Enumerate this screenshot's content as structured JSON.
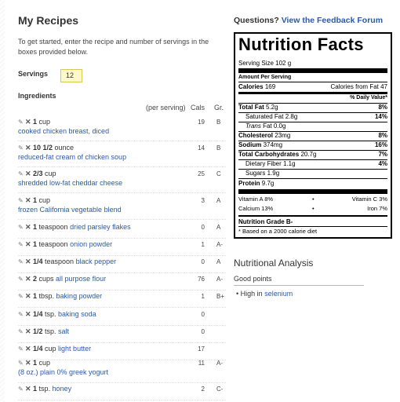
{
  "recipes": {
    "title": "My Recipes",
    "intro": "To get started, enter the recipe and number of servings in the boxes provided below.",
    "servings_label": "Servings",
    "servings_value": "12",
    "ingredients_label": "Ingredients",
    "col_per_serving": "(per serving)",
    "col_cals": "Cals",
    "col_gr": "Gr.",
    "items": [
      {
        "qty": "1",
        "unit": "cup",
        "name": "cooked chicken breast, diced",
        "cals": "19",
        "grade": "B"
      },
      {
        "qty": "10 1/2",
        "unit": "ounce",
        "name": "reduced-fat cream of chicken soup",
        "cals": "14",
        "grade": "B"
      },
      {
        "qty": "2/3",
        "unit": "cup",
        "name": "shredded low-fat cheddar cheese",
        "cals": "25",
        "grade": "C"
      },
      {
        "qty": "1",
        "unit": "cup",
        "name": "frozen California vegetable blend",
        "cals": "3",
        "grade": "A"
      },
      {
        "qty": "1",
        "unit": "teaspoon",
        "name": "dried parsley flakes",
        "cals": "0",
        "grade": "A"
      },
      {
        "qty": "1",
        "unit": "teaspoon",
        "name": "onion powder",
        "cals": "1",
        "grade": "A-"
      },
      {
        "qty": "1/4",
        "unit": "teaspoon",
        "name": "black pepper",
        "cals": "0",
        "grade": "A"
      },
      {
        "qty": "2",
        "unit": "cups",
        "name": "all purpose flour",
        "cals": "76",
        "grade": "A-"
      },
      {
        "qty": "1",
        "unit": "tbsp.",
        "name": "baking powder",
        "cals": "1",
        "grade": "B+"
      },
      {
        "qty": "1/4",
        "unit": "tsp.",
        "name": "baking soda",
        "cals": "0",
        "grade": ""
      },
      {
        "qty": "1/2",
        "unit": "tsp.",
        "name": "salt",
        "cals": "0",
        "grade": ""
      },
      {
        "qty": "1/4",
        "unit": "cup",
        "name": "light butter",
        "cals": "17",
        "grade": ""
      },
      {
        "qty": "1",
        "unit": "cup",
        "name": "(8 oz.) plain 0% greek yogurt",
        "cals": "11",
        "grade": "A-"
      },
      {
        "qty": "1",
        "unit": "tsp.",
        "name": "honey",
        "cals": "2",
        "grade": "C-"
      }
    ]
  },
  "feedback": {
    "question": "Questions?",
    "link": "View the Feedback Forum"
  },
  "nutrition": {
    "title": "Nutrition Facts",
    "serving_size": "Serving Size 102 g",
    "amount_per_serving": "Amount Per Serving",
    "calories_label": "Calories",
    "calories_value": "169",
    "calories_fat": "Calories from Fat 47",
    "daily_value_hdr": "% Daily Value*",
    "total_fat": "Total Fat",
    "total_fat_val": "5.2g",
    "total_fat_pct": "8%",
    "sat_fat": "Saturated Fat",
    "sat_fat_val": "2.8g",
    "sat_fat_pct": "14%",
    "trans_fat": "Trans",
    "trans_fat_rest": "Fat 0.0g",
    "cholesterol": "Cholesterol",
    "cholesterol_val": "23mg",
    "cholesterol_pct": "8%",
    "sodium": "Sodium",
    "sodium_val": "374mg",
    "sodium_pct": "16%",
    "carbs": "Total Carbohydrates",
    "carbs_val": "20.7g",
    "carbs_pct": "7%",
    "fiber": "Dietary Fiber 1.1g",
    "fiber_pct": "4%",
    "sugars": "Sugars 1.9g",
    "protein": "Protein",
    "protein_val": "9.7g",
    "vit_a": "Vitamin A 8%",
    "vit_c": "Vitamin C 3%",
    "calcium": "Calcium 13%",
    "iron": "Iron 7%",
    "grade": "Nutrition Grade B-",
    "footnote": "* Based on a 2000 calorie diet"
  },
  "analysis": {
    "title": "Nutritional Analysis",
    "good_points": "Good points",
    "point_prefix": "High in",
    "point_link": "selenium"
  }
}
